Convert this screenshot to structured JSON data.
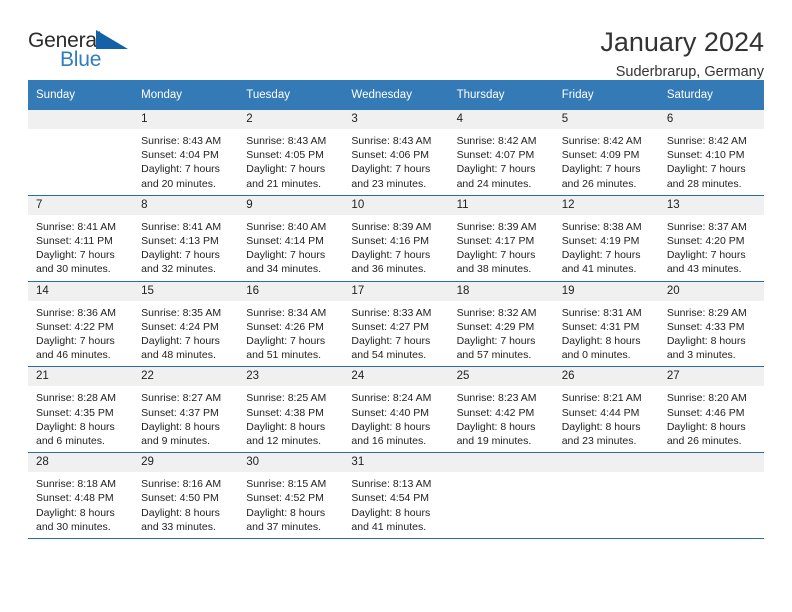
{
  "brand": {
    "word_one": "General",
    "word_two": "Blue",
    "triangle_icon": "triangle-icon"
  },
  "header": {
    "month_title": "January 2024",
    "location": "Suderbrarup, Germany"
  },
  "colors": {
    "header_blue": "#337ab7",
    "brand_blue": "#2f7ec1",
    "row_divider": "#2d6ca2",
    "daynum_bg": "#f0f0f0"
  },
  "calendar": {
    "weekday_headers": [
      "Sunday",
      "Monday",
      "Tuesday",
      "Wednesday",
      "Thursday",
      "Friday",
      "Saturday"
    ],
    "weeks": [
      [
        {
          "day": "",
          "sunrise": "",
          "sunset": "",
          "daylight_line1": "",
          "daylight_line2": ""
        },
        {
          "day": "1",
          "sunrise": "Sunrise: 8:43 AM",
          "sunset": "Sunset: 4:04 PM",
          "daylight_line1": "Daylight: 7 hours",
          "daylight_line2": "and 20 minutes."
        },
        {
          "day": "2",
          "sunrise": "Sunrise: 8:43 AM",
          "sunset": "Sunset: 4:05 PM",
          "daylight_line1": "Daylight: 7 hours",
          "daylight_line2": "and 21 minutes."
        },
        {
          "day": "3",
          "sunrise": "Sunrise: 8:43 AM",
          "sunset": "Sunset: 4:06 PM",
          "daylight_line1": "Daylight: 7 hours",
          "daylight_line2": "and 23 minutes."
        },
        {
          "day": "4",
          "sunrise": "Sunrise: 8:42 AM",
          "sunset": "Sunset: 4:07 PM",
          "daylight_line1": "Daylight: 7 hours",
          "daylight_line2": "and 24 minutes."
        },
        {
          "day": "5",
          "sunrise": "Sunrise: 8:42 AM",
          "sunset": "Sunset: 4:09 PM",
          "daylight_line1": "Daylight: 7 hours",
          "daylight_line2": "and 26 minutes."
        },
        {
          "day": "6",
          "sunrise": "Sunrise: 8:42 AM",
          "sunset": "Sunset: 4:10 PM",
          "daylight_line1": "Daylight: 7 hours",
          "daylight_line2": "and 28 minutes."
        }
      ],
      [
        {
          "day": "7",
          "sunrise": "Sunrise: 8:41 AM",
          "sunset": "Sunset: 4:11 PM",
          "daylight_line1": "Daylight: 7 hours",
          "daylight_line2": "and 30 minutes."
        },
        {
          "day": "8",
          "sunrise": "Sunrise: 8:41 AM",
          "sunset": "Sunset: 4:13 PM",
          "daylight_line1": "Daylight: 7 hours",
          "daylight_line2": "and 32 minutes."
        },
        {
          "day": "9",
          "sunrise": "Sunrise: 8:40 AM",
          "sunset": "Sunset: 4:14 PM",
          "daylight_line1": "Daylight: 7 hours",
          "daylight_line2": "and 34 minutes."
        },
        {
          "day": "10",
          "sunrise": "Sunrise: 8:39 AM",
          "sunset": "Sunset: 4:16 PM",
          "daylight_line1": "Daylight: 7 hours",
          "daylight_line2": "and 36 minutes."
        },
        {
          "day": "11",
          "sunrise": "Sunrise: 8:39 AM",
          "sunset": "Sunset: 4:17 PM",
          "daylight_line1": "Daylight: 7 hours",
          "daylight_line2": "and 38 minutes."
        },
        {
          "day": "12",
          "sunrise": "Sunrise: 8:38 AM",
          "sunset": "Sunset: 4:19 PM",
          "daylight_line1": "Daylight: 7 hours",
          "daylight_line2": "and 41 minutes."
        },
        {
          "day": "13",
          "sunrise": "Sunrise: 8:37 AM",
          "sunset": "Sunset: 4:20 PM",
          "daylight_line1": "Daylight: 7 hours",
          "daylight_line2": "and 43 minutes."
        }
      ],
      [
        {
          "day": "14",
          "sunrise": "Sunrise: 8:36 AM",
          "sunset": "Sunset: 4:22 PM",
          "daylight_line1": "Daylight: 7 hours",
          "daylight_line2": "and 46 minutes."
        },
        {
          "day": "15",
          "sunrise": "Sunrise: 8:35 AM",
          "sunset": "Sunset: 4:24 PM",
          "daylight_line1": "Daylight: 7 hours",
          "daylight_line2": "and 48 minutes."
        },
        {
          "day": "16",
          "sunrise": "Sunrise: 8:34 AM",
          "sunset": "Sunset: 4:26 PM",
          "daylight_line1": "Daylight: 7 hours",
          "daylight_line2": "and 51 minutes."
        },
        {
          "day": "17",
          "sunrise": "Sunrise: 8:33 AM",
          "sunset": "Sunset: 4:27 PM",
          "daylight_line1": "Daylight: 7 hours",
          "daylight_line2": "and 54 minutes."
        },
        {
          "day": "18",
          "sunrise": "Sunrise: 8:32 AM",
          "sunset": "Sunset: 4:29 PM",
          "daylight_line1": "Daylight: 7 hours",
          "daylight_line2": "and 57 minutes."
        },
        {
          "day": "19",
          "sunrise": "Sunrise: 8:31 AM",
          "sunset": "Sunset: 4:31 PM",
          "daylight_line1": "Daylight: 8 hours",
          "daylight_line2": "and 0 minutes."
        },
        {
          "day": "20",
          "sunrise": "Sunrise: 8:29 AM",
          "sunset": "Sunset: 4:33 PM",
          "daylight_line1": "Daylight: 8 hours",
          "daylight_line2": "and 3 minutes."
        }
      ],
      [
        {
          "day": "21",
          "sunrise": "Sunrise: 8:28 AM",
          "sunset": "Sunset: 4:35 PM",
          "daylight_line1": "Daylight: 8 hours",
          "daylight_line2": "and 6 minutes."
        },
        {
          "day": "22",
          "sunrise": "Sunrise: 8:27 AM",
          "sunset": "Sunset: 4:37 PM",
          "daylight_line1": "Daylight: 8 hours",
          "daylight_line2": "and 9 minutes."
        },
        {
          "day": "23",
          "sunrise": "Sunrise: 8:25 AM",
          "sunset": "Sunset: 4:38 PM",
          "daylight_line1": "Daylight: 8 hours",
          "daylight_line2": "and 12 minutes."
        },
        {
          "day": "24",
          "sunrise": "Sunrise: 8:24 AM",
          "sunset": "Sunset: 4:40 PM",
          "daylight_line1": "Daylight: 8 hours",
          "daylight_line2": "and 16 minutes."
        },
        {
          "day": "25",
          "sunrise": "Sunrise: 8:23 AM",
          "sunset": "Sunset: 4:42 PM",
          "daylight_line1": "Daylight: 8 hours",
          "daylight_line2": "and 19 minutes."
        },
        {
          "day": "26",
          "sunrise": "Sunrise: 8:21 AM",
          "sunset": "Sunset: 4:44 PM",
          "daylight_line1": "Daylight: 8 hours",
          "daylight_line2": "and 23 minutes."
        },
        {
          "day": "27",
          "sunrise": "Sunrise: 8:20 AM",
          "sunset": "Sunset: 4:46 PM",
          "daylight_line1": "Daylight: 8 hours",
          "daylight_line2": "and 26 minutes."
        }
      ],
      [
        {
          "day": "28",
          "sunrise": "Sunrise: 8:18 AM",
          "sunset": "Sunset: 4:48 PM",
          "daylight_line1": "Daylight: 8 hours",
          "daylight_line2": "and 30 minutes."
        },
        {
          "day": "29",
          "sunrise": "Sunrise: 8:16 AM",
          "sunset": "Sunset: 4:50 PM",
          "daylight_line1": "Daylight: 8 hours",
          "daylight_line2": "and 33 minutes."
        },
        {
          "day": "30",
          "sunrise": "Sunrise: 8:15 AM",
          "sunset": "Sunset: 4:52 PM",
          "daylight_line1": "Daylight: 8 hours",
          "daylight_line2": "and 37 minutes."
        },
        {
          "day": "31",
          "sunrise": "Sunrise: 8:13 AM",
          "sunset": "Sunset: 4:54 PM",
          "daylight_line1": "Daylight: 8 hours",
          "daylight_line2": "and 41 minutes."
        },
        {
          "day": "",
          "sunrise": "",
          "sunset": "",
          "daylight_line1": "",
          "daylight_line2": ""
        },
        {
          "day": "",
          "sunrise": "",
          "sunset": "",
          "daylight_line1": "",
          "daylight_line2": ""
        },
        {
          "day": "",
          "sunrise": "",
          "sunset": "",
          "daylight_line1": "",
          "daylight_line2": ""
        }
      ]
    ]
  }
}
